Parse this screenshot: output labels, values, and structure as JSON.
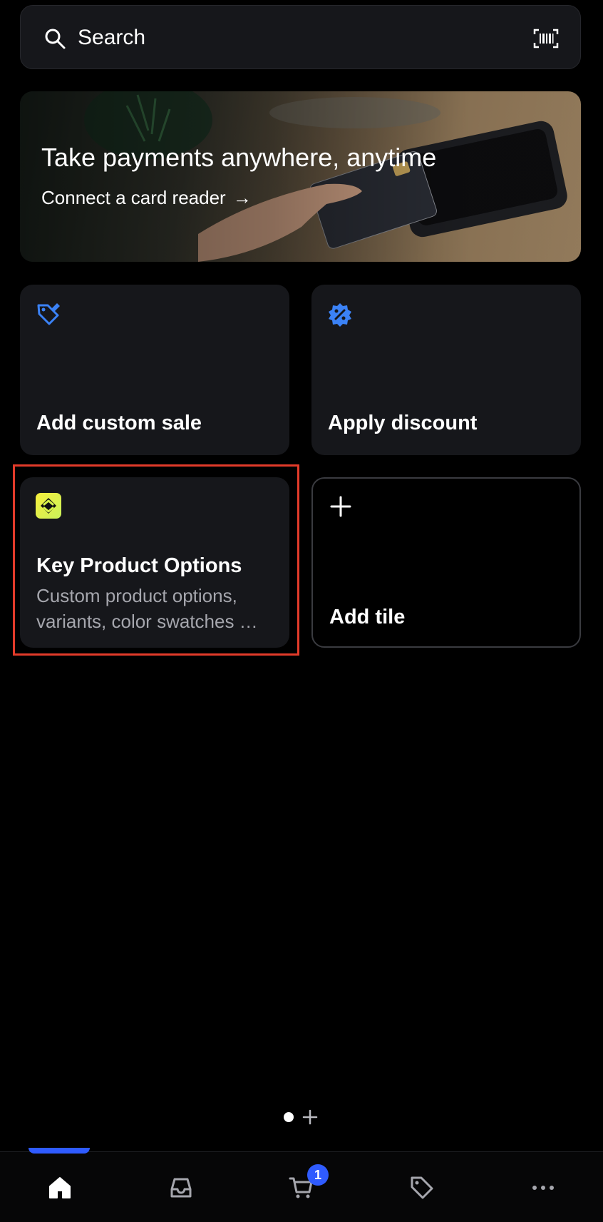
{
  "search": {
    "label": "Search",
    "icon": "search-icon",
    "scan_icon": "barcode-scan-icon"
  },
  "banner": {
    "title": "Take payments anywhere, anytime",
    "link_label": "Connect a card reader",
    "link_icon": "arrow-right-icon"
  },
  "tiles": [
    {
      "title": "Add custom sale",
      "icon": "tag-edit-icon",
      "icon_color": "#3b82f6"
    },
    {
      "title": "Apply discount",
      "icon": "discount-badge-icon",
      "icon_color": "#3b82f6"
    },
    {
      "title": "Key Product Options",
      "description_line1": "Custom product options,",
      "description_line2": "variants, color swatches …",
      "icon": "app-logo-icon"
    },
    {
      "title": "Add tile",
      "icon": "plus-icon"
    }
  ],
  "page_indicator": {
    "current_page": 1,
    "add_icon": "plus-icon"
  },
  "bottom_nav": {
    "items": [
      {
        "name": "home",
        "icon": "home-icon",
        "active": true
      },
      {
        "name": "inbox",
        "icon": "inbox-icon"
      },
      {
        "name": "cart",
        "icon": "cart-icon",
        "badge": "1"
      },
      {
        "name": "products",
        "icon": "tag-icon"
      },
      {
        "name": "more",
        "icon": "more-icon"
      }
    ]
  },
  "colors": {
    "accent": "#2f5bff",
    "highlight": "#e23b2a",
    "tile_bg": "#16171b"
  }
}
